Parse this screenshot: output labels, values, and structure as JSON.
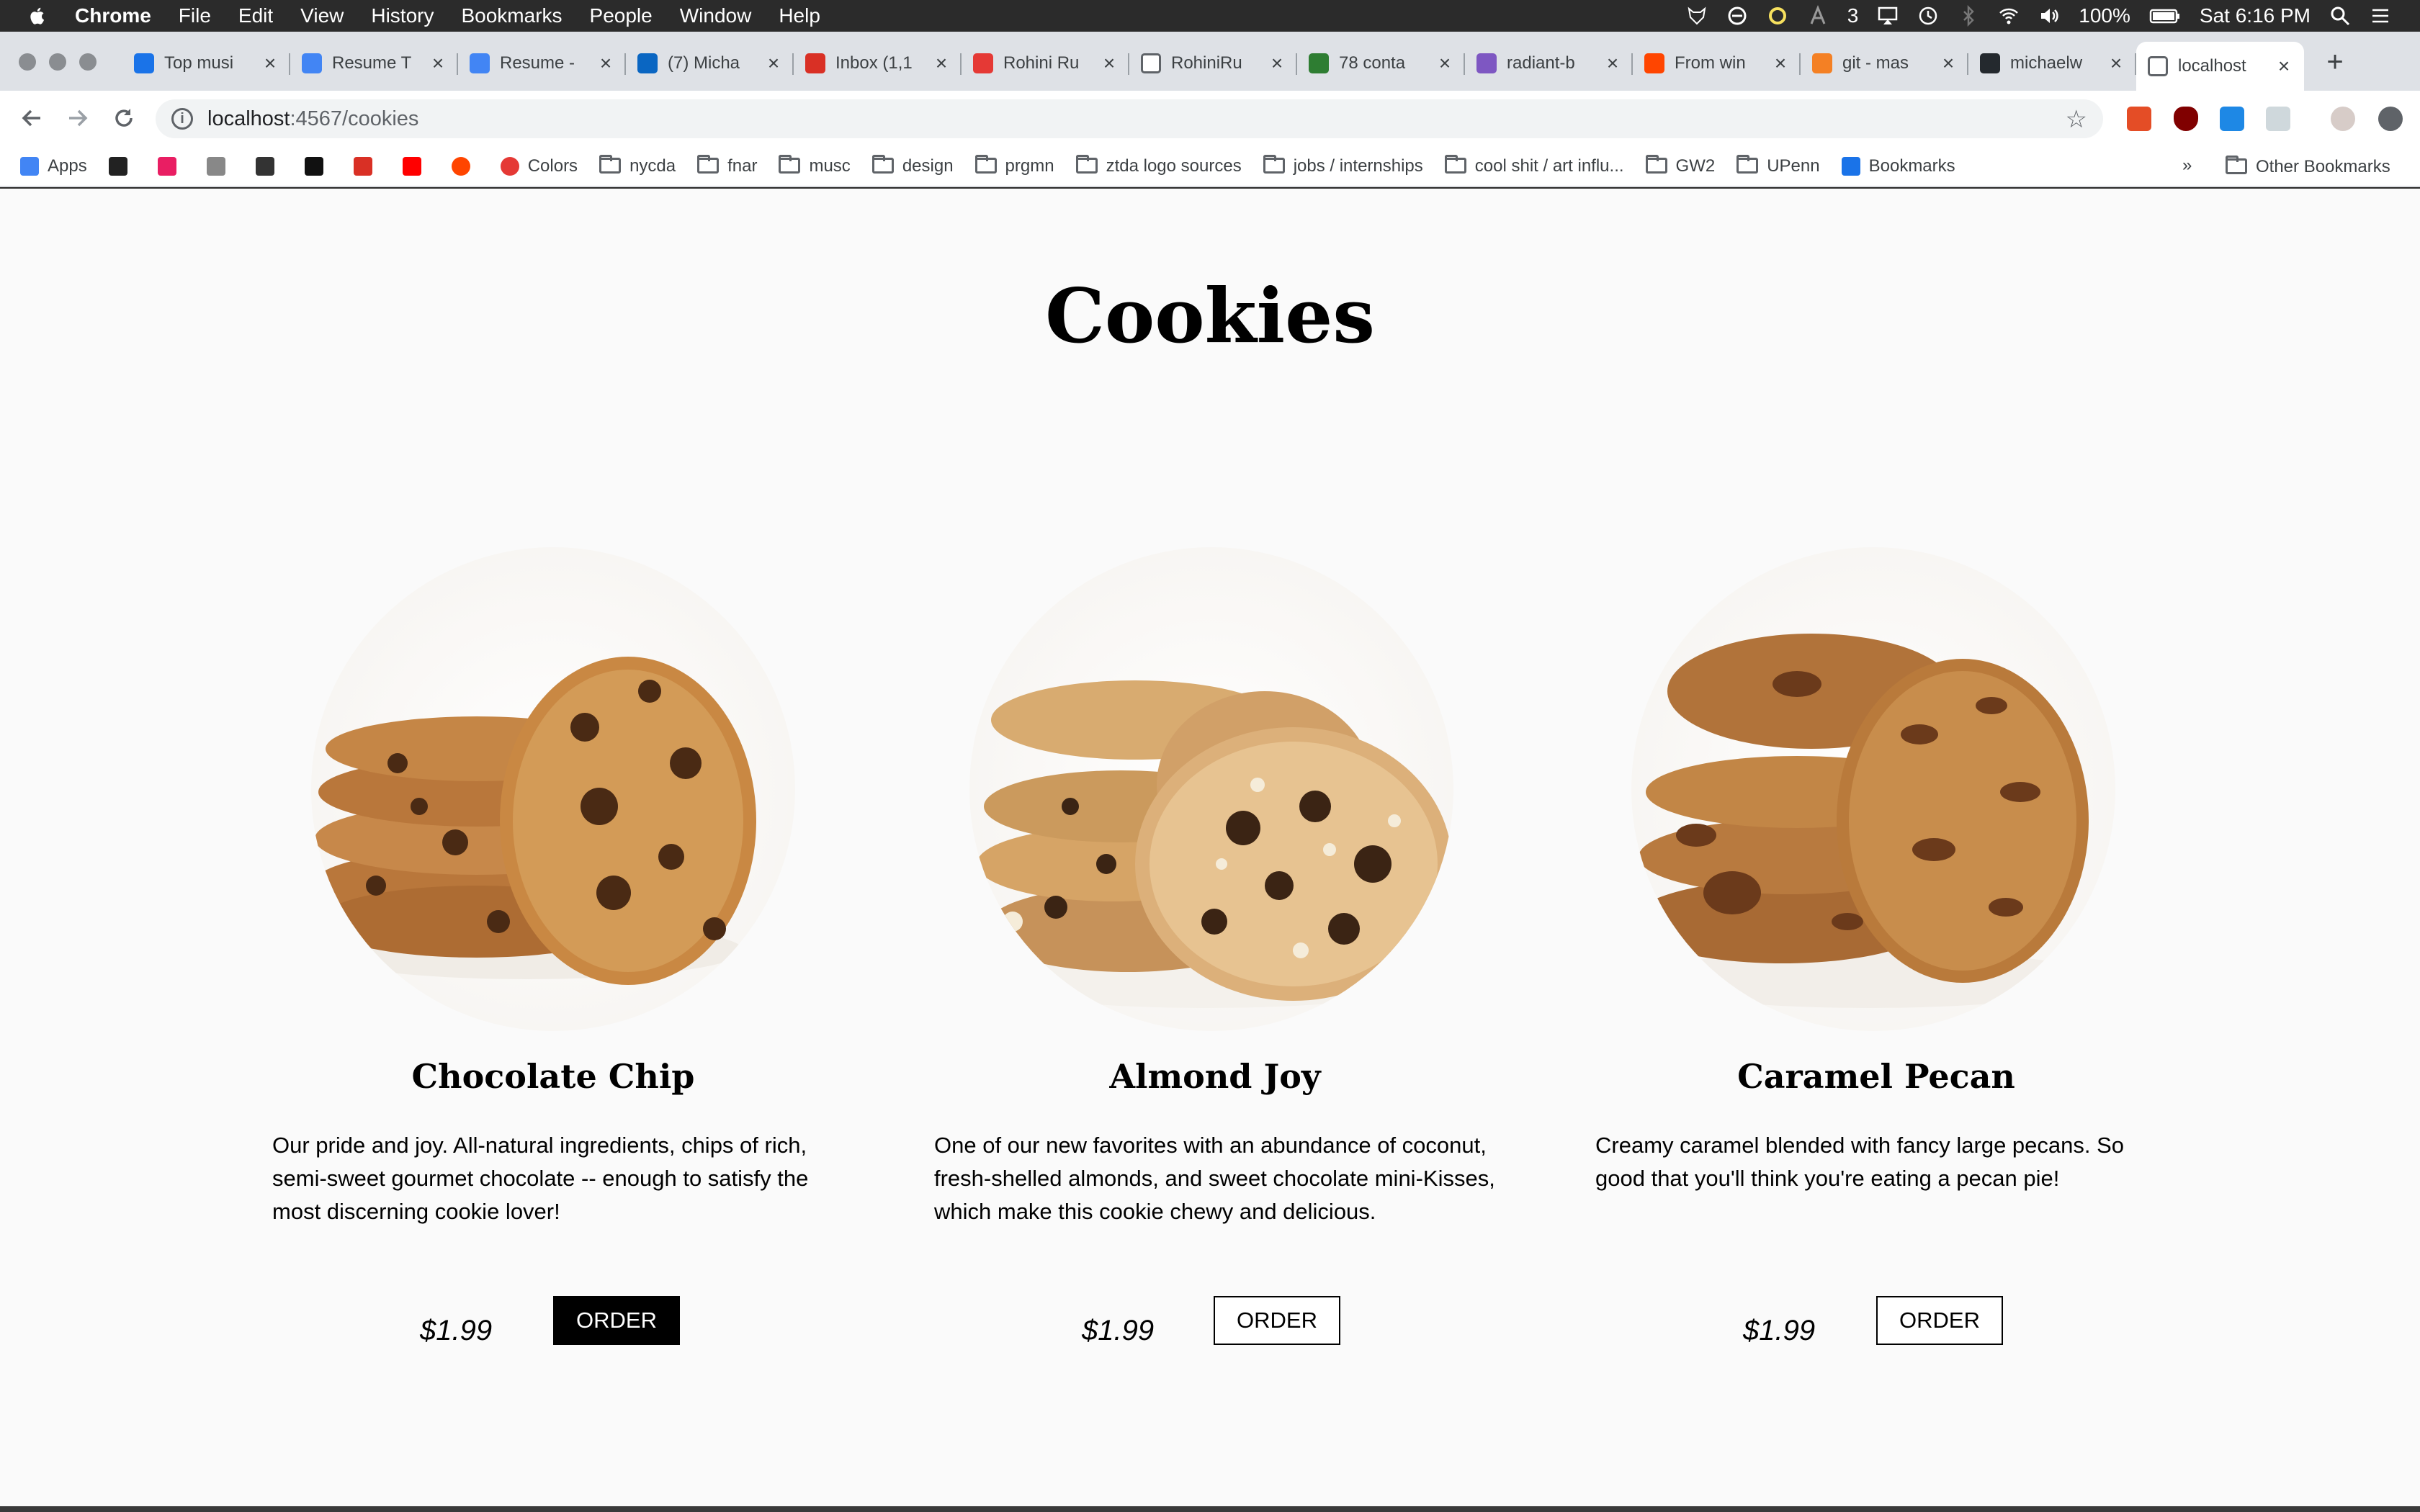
{
  "menubar": {
    "app": "Chrome",
    "items": [
      "File",
      "Edit",
      "View",
      "History",
      "Bookmarks",
      "People",
      "Window",
      "Help"
    ],
    "status": {
      "badge": "3",
      "battery": "100%",
      "clock": "Sat 6:16 PM"
    }
  },
  "tabs": [
    {
      "title": "Top musi",
      "icon": "p-icon",
      "color": "#1a73e8"
    },
    {
      "title": "Resume T",
      "icon": "docs-icon",
      "color": "#4285f4"
    },
    {
      "title": "Resume -",
      "icon": "docs-icon",
      "color": "#4285f4"
    },
    {
      "title": "(7) Micha",
      "icon": "linkedin-icon",
      "color": "#0a66c2"
    },
    {
      "title": "Inbox (1,1",
      "icon": "gmail-icon",
      "color": "#d93025"
    },
    {
      "title": "Rohini Ru",
      "icon": "strawberry-icon",
      "color": "#e53935"
    },
    {
      "title": "RohiniRu",
      "icon": "file-icon",
      "color": "#ffffff"
    },
    {
      "title": "78 conta",
      "icon": "v-icon",
      "color": "#2e7d32"
    },
    {
      "title": "radiant-b",
      "icon": "h-icon",
      "color": "#7e57c2"
    },
    {
      "title": "From win",
      "icon": "reddit-icon",
      "color": "#ff4500"
    },
    {
      "title": "git - mas",
      "icon": "stackoverflow-icon",
      "color": "#f48024"
    },
    {
      "title": "michaelw",
      "icon": "github-icon",
      "color": "#24292e"
    },
    {
      "title": "localhost",
      "icon": "file-icon",
      "color": "#ffffff",
      "active": true
    }
  ],
  "omnibox": {
    "host": "localhost",
    "path": ":4567/cookies"
  },
  "bookmarks": [
    {
      "label": "Apps",
      "icon": "apps-grid-icon"
    },
    {
      "label": "",
      "icon": "bbc-icon"
    },
    {
      "label": "",
      "icon": "color-grid-icon"
    },
    {
      "label": "",
      "icon": "apple-icon"
    },
    {
      "label": "",
      "icon": "shopping-bag-icon"
    },
    {
      "label": "",
      "icon": "amazon-icon"
    },
    {
      "label": "",
      "icon": "gmail-icon"
    },
    {
      "label": "",
      "icon": "youtube-icon"
    },
    {
      "label": "",
      "icon": "reddit-icon"
    },
    {
      "label": "Colors",
      "icon": "colors-icon"
    },
    {
      "label": "nycda",
      "icon": "folder-icon"
    },
    {
      "label": "fnar",
      "icon": "folder-icon"
    },
    {
      "label": "musc",
      "icon": "folder-icon"
    },
    {
      "label": "design",
      "icon": "folder-icon"
    },
    {
      "label": "prgmn",
      "icon": "folder-icon"
    },
    {
      "label": "ztda logo sources",
      "icon": "folder-icon"
    },
    {
      "label": "jobs / internships",
      "icon": "folder-icon"
    },
    {
      "label": "cool shit / art influ...",
      "icon": "folder-icon"
    },
    {
      "label": "GW2",
      "icon": "folder-icon"
    },
    {
      "label": "UPenn",
      "icon": "folder-icon"
    },
    {
      "label": "Bookmarks",
      "icon": "star-icon"
    }
  ],
  "bookmarks_overflow": "»",
  "other_bookmarks": "Other Bookmarks",
  "page": {
    "title": "Cookies",
    "products": [
      {
        "name": "Chocolate Chip",
        "description": "Our pride and joy. All-natural ingredients, chips of rich, semi-sweet gourmet chocolate -- enough to satisfy the most discerning cookie lover!",
        "price": "$1.99",
        "button": "ORDER",
        "button_style": "filled"
      },
      {
        "name": "Almond Joy",
        "description": "One of our new favorites with an abundance of coconut, fresh-shelled almonds, and sweet chocolate mini-Kisses, which make this cookie chewy and delicious.",
        "price": "$1.99",
        "button": "ORDER",
        "button_style": "outline"
      },
      {
        "name": "Caramel Pecan",
        "description": "Creamy caramel blended with fancy large pecans. So good that you'll think you're eating a pecan pie!",
        "price": "$1.99",
        "button": "ORDER",
        "button_style": "outline"
      }
    ]
  }
}
